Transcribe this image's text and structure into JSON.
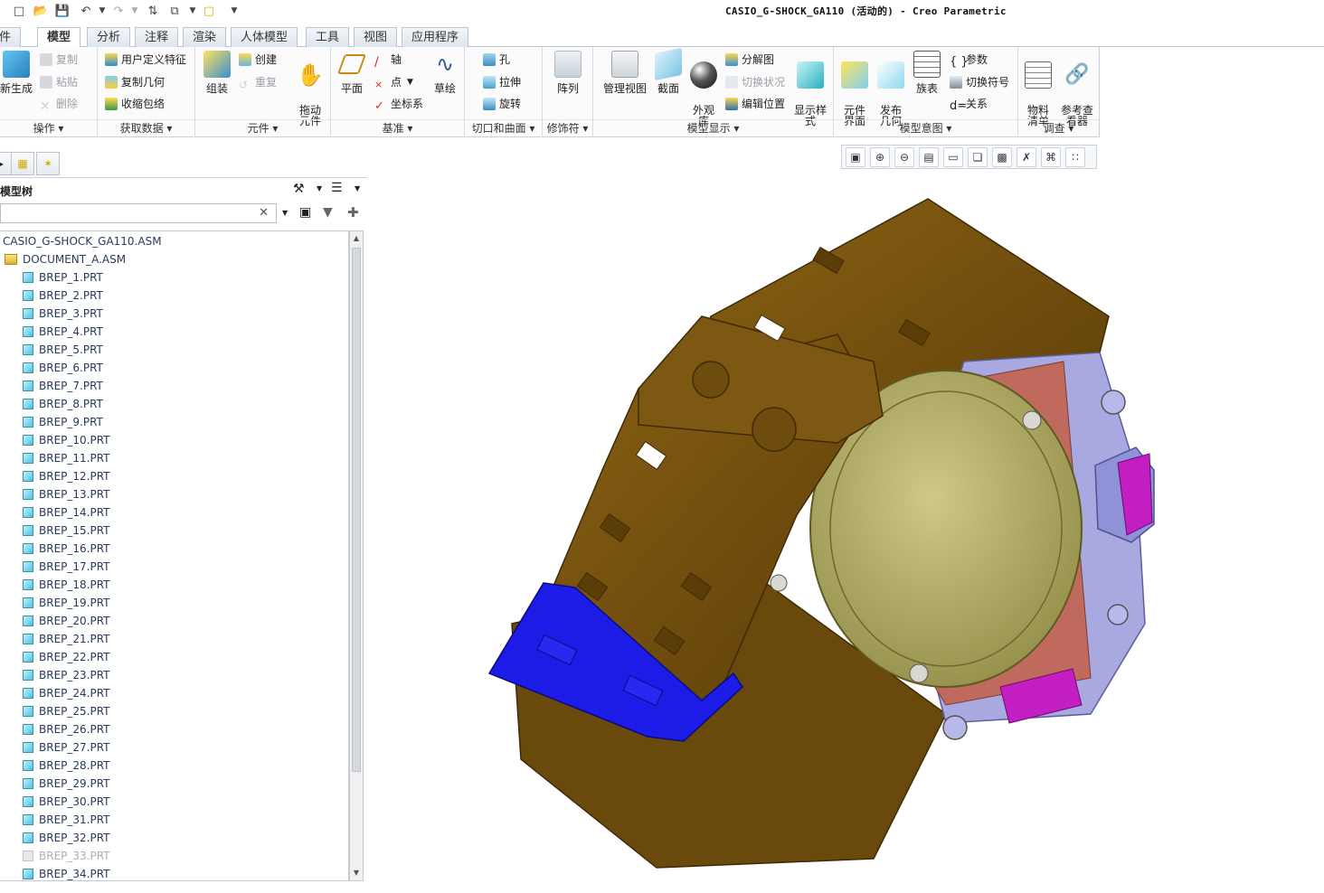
{
  "window": {
    "title": "CASIO_G-SHOCK_GA110 (活动的) - Creo Parametric"
  },
  "quick_access": [
    "new-icon",
    "open-icon",
    "save-icon",
    "undo-icon",
    "redo-icon",
    "regenerate-icon",
    "windows-icon",
    "folder-icon",
    "customize-icon"
  ],
  "tabs": [
    {
      "label": "件"
    },
    {
      "label": "模型",
      "active": true
    },
    {
      "label": "分析"
    },
    {
      "label": "注释"
    },
    {
      "label": "渲染"
    },
    {
      "label": "人体模型"
    },
    {
      "label": "工具"
    },
    {
      "label": "视图"
    },
    {
      "label": "应用程序"
    }
  ],
  "ribbon": {
    "groups": {
      "operations": "操作",
      "get_data": "获取数据",
      "components": "元件",
      "datum": "基准",
      "cut_surface": "切口和曲面",
      "modifiers": "修饰符",
      "model_display": "模型显示",
      "model_intent": "模型意图",
      "investigate": "调查"
    },
    "buttons": {
      "regenerate": "新生成",
      "copy": "复制",
      "paste": "粘贴",
      "delete": "删除",
      "user_defined_feature": "用户定义特征",
      "copy_geometry": "复制几何",
      "shrinkwrap": "收缩包络",
      "assemble": "组装",
      "create": "创建",
      "repeat": "重复",
      "drag_components": "拖动\n元件",
      "plane": "平面",
      "axis": "轴",
      "point": "点",
      "csys": "坐标系",
      "sketch": "草绘",
      "hole": "孔",
      "extrude": "拉伸",
      "revolve": "旋转",
      "pattern": "阵列",
      "manage_views": "管理视图",
      "section": "截面",
      "appearance_gallery": "外观\n库",
      "explode_view": "分解图",
      "toggle_status": "切换状况",
      "edit_position": "编辑位置",
      "display_style": "显示样\n式",
      "component_interface": "元件\n界面",
      "publish_geometry": "发布\n几何",
      "family_table": "族表",
      "parameters": "参数",
      "switch_symbols": "切换符号",
      "relations": "关系",
      "bill_of_materials": "物料\n清单",
      "reference_viewer": "参考查\n看器"
    }
  },
  "view_toolbar": [
    "refit-icon",
    "zoom-in-icon",
    "zoom-out-icon",
    "repaint-icon",
    "display-style-icon",
    "saved-views-icon",
    "view-manager-icon",
    "datum-display-icon",
    "spin-center-icon",
    "annotation-display-icon"
  ],
  "model_tree": {
    "title": "模型树",
    "search_placeholder": "",
    "items": [
      {
        "label": "CASIO_G-SHOCK_GA110.ASM",
        "type": "root"
      },
      {
        "label": "DOCUMENT_A.ASM",
        "type": "asm"
      },
      {
        "label": "BREP_1.PRT",
        "type": "prt"
      },
      {
        "label": "BREP_2.PRT",
        "type": "prt"
      },
      {
        "label": "BREP_3.PRT",
        "type": "prt"
      },
      {
        "label": "BREP_4.PRT",
        "type": "prt"
      },
      {
        "label": "BREP_5.PRT",
        "type": "prt"
      },
      {
        "label": "BREP_6.PRT",
        "type": "prt"
      },
      {
        "label": "BREP_7.PRT",
        "type": "prt"
      },
      {
        "label": "BREP_8.PRT",
        "type": "prt"
      },
      {
        "label": "BREP_9.PRT",
        "type": "prt"
      },
      {
        "label": "BREP_10.PRT",
        "type": "prt"
      },
      {
        "label": "BREP_11.PRT",
        "type": "prt"
      },
      {
        "label": "BREP_12.PRT",
        "type": "prt"
      },
      {
        "label": "BREP_13.PRT",
        "type": "prt"
      },
      {
        "label": "BREP_14.PRT",
        "type": "prt"
      },
      {
        "label": "BREP_15.PRT",
        "type": "prt"
      },
      {
        "label": "BREP_16.PRT",
        "type": "prt"
      },
      {
        "label": "BREP_17.PRT",
        "type": "prt"
      },
      {
        "label": "BREP_18.PRT",
        "type": "prt"
      },
      {
        "label": "BREP_19.PRT",
        "type": "prt"
      },
      {
        "label": "BREP_20.PRT",
        "type": "prt"
      },
      {
        "label": "BREP_21.PRT",
        "type": "prt"
      },
      {
        "label": "BREP_22.PRT",
        "type": "prt"
      },
      {
        "label": "BREP_23.PRT",
        "type": "prt"
      },
      {
        "label": "BREP_24.PRT",
        "type": "prt"
      },
      {
        "label": "BREP_25.PRT",
        "type": "prt"
      },
      {
        "label": "BREP_26.PRT",
        "type": "prt"
      },
      {
        "label": "BREP_27.PRT",
        "type": "prt"
      },
      {
        "label": "BREP_28.PRT",
        "type": "prt"
      },
      {
        "label": "BREP_29.PRT",
        "type": "prt"
      },
      {
        "label": "BREP_30.PRT",
        "type": "prt"
      },
      {
        "label": "BREP_31.PRT",
        "type": "prt"
      },
      {
        "label": "BREP_32.PRT",
        "type": "prt"
      },
      {
        "label": "BREP_33.PRT",
        "type": "prt",
        "suppressed": true
      },
      {
        "label": "BREP_34.PRT",
        "type": "prt"
      }
    ]
  },
  "colors": {
    "strap": "#7a5410",
    "strap_dark": "#4f3507",
    "buckle": "#1c1ce6",
    "caseback": "#b9b370",
    "bezel": "#a7a9e0",
    "ring": "#c06a5e",
    "button_accent": "#c21ec2"
  }
}
